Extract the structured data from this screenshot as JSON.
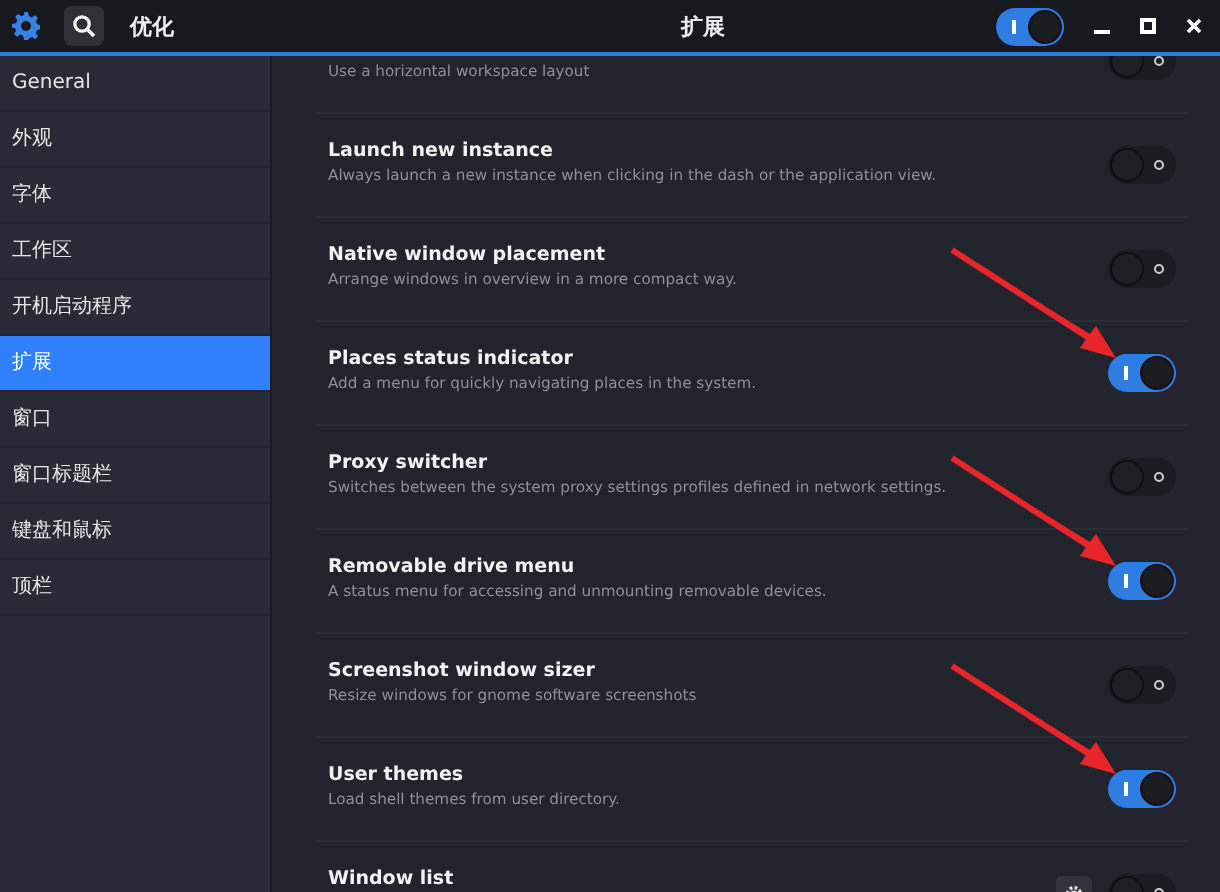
{
  "header": {
    "app_title": "优化",
    "page_title": "扩展",
    "extensions_on": true
  },
  "sidebar": {
    "items": [
      {
        "label": "General",
        "selected": false
      },
      {
        "label": "外观",
        "selected": false
      },
      {
        "label": "字体",
        "selected": false
      },
      {
        "label": "工作区",
        "selected": false
      },
      {
        "label": "开机启动程序",
        "selected": false
      },
      {
        "label": "扩展",
        "selected": true
      },
      {
        "label": "窗口",
        "selected": false
      },
      {
        "label": "窗口标题栏",
        "selected": false
      },
      {
        "label": "键盘和鼠标",
        "selected": false
      },
      {
        "label": "顶栏",
        "selected": false
      }
    ]
  },
  "extensions": [
    {
      "description": "Use a horizontal workspace layout",
      "on": false,
      "arrow": false,
      "settings": false
    },
    {
      "title": "Launch new instance",
      "description": "Always launch a new instance when clicking in the dash or the application view.",
      "on": false,
      "arrow": false,
      "settings": false
    },
    {
      "title": "Native window placement",
      "description": "Arrange windows in overview in a more compact way.",
      "on": false,
      "arrow": false,
      "settings": false
    },
    {
      "title": "Places status indicator",
      "description": "Add a menu for quickly navigating places in the system.",
      "on": true,
      "arrow": true,
      "settings": false
    },
    {
      "title": "Proxy switcher",
      "description": "Switches between the system proxy settings profiles defined in network settings.",
      "on": false,
      "arrow": false,
      "settings": false
    },
    {
      "title": "Removable drive menu",
      "description": "A status menu for accessing and unmounting removable devices.",
      "on": true,
      "arrow": true,
      "settings": false
    },
    {
      "title": "Screenshot window sizer",
      "description": "Resize windows for gnome software screenshots",
      "on": false,
      "arrow": false,
      "settings": false
    },
    {
      "title": "User themes",
      "description": "Load shell themes from user directory.",
      "on": true,
      "arrow": true,
      "settings": false
    },
    {
      "title": "Window list",
      "on": false,
      "arrow": false,
      "settings": true
    }
  ]
}
